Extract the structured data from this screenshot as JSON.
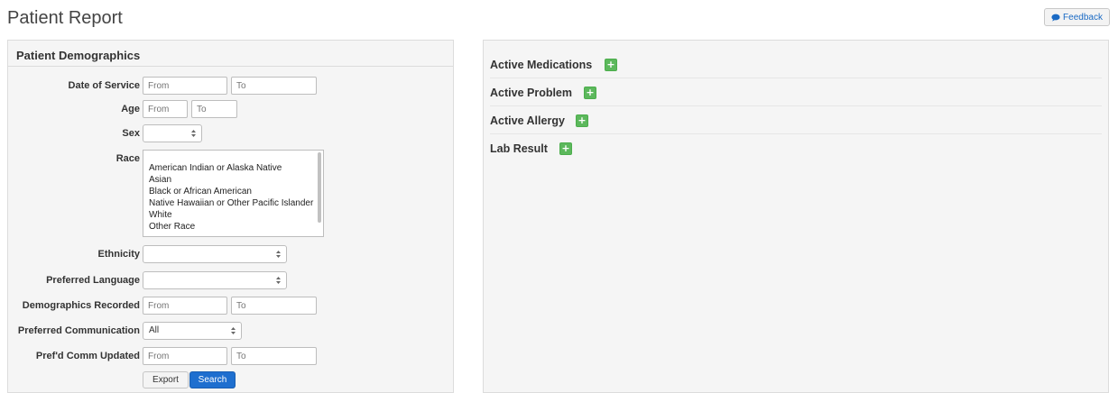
{
  "header": {
    "title": "Patient Report",
    "feedback_label": "Feedback"
  },
  "demographics": {
    "title": "Patient Demographics",
    "date_of_service": {
      "label": "Date of Service",
      "from_placeholder": "From",
      "to_placeholder": "To"
    },
    "age": {
      "label": "Age",
      "from_placeholder": "From",
      "to_placeholder": "To"
    },
    "sex": {
      "label": "Sex",
      "value": ""
    },
    "race": {
      "label": "Race",
      "options": [
        "American Indian or Alaska Native",
        "Asian",
        "Black or African American",
        "Native Hawaiian or Other Pacific Islander",
        "White",
        "Other Race"
      ]
    },
    "ethnicity": {
      "label": "Ethnicity",
      "value": ""
    },
    "preferred_language": {
      "label": "Preferred Language",
      "value": ""
    },
    "demographics_recorded": {
      "label": "Demographics Recorded",
      "from_placeholder": "From",
      "to_placeholder": "To"
    },
    "preferred_communication": {
      "label": "Preferred Communication",
      "value": "All"
    },
    "prefd_comm_updated": {
      "label": "Pref'd Comm Updated",
      "from_placeholder": "From",
      "to_placeholder": "To"
    },
    "export_label": "Export",
    "search_label": "Search"
  },
  "clinical": {
    "sections": [
      {
        "title": "Active Medications",
        "add": "+"
      },
      {
        "title": "Active Problem",
        "add": "+"
      },
      {
        "title": "Active Allergy",
        "add": "+"
      },
      {
        "title": "Lab Result",
        "add": "+"
      }
    ]
  },
  "colors": {
    "primary_button": "#1e6fcf",
    "add_button": "#5cb85c",
    "panel_bg": "#f5f5f5"
  },
  "icons": {
    "feedback": "chat-bubble-icon",
    "select_caret": "up-down-caret-icon"
  }
}
